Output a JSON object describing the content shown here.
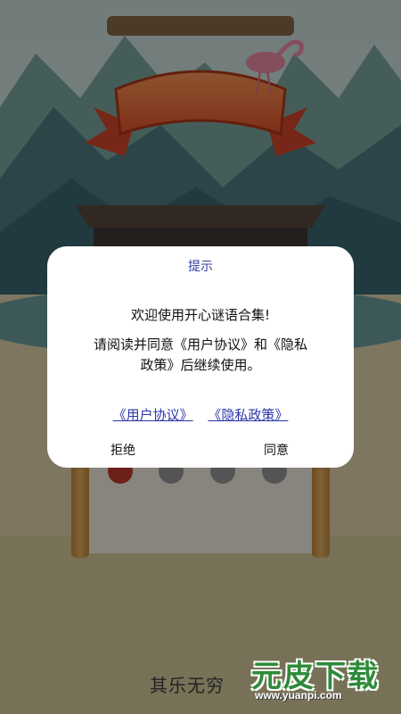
{
  "dialog": {
    "title": "提示",
    "welcome": "欢迎使用开心谜语合集!",
    "body_line1": "请阅读并同意《用户协议》和《隐私",
    "body_line2": "政策》后继续使用。",
    "link_user_agreement": "《用户协议》",
    "link_privacy_policy": "《隐私政策》",
    "reject_label": "拒绝",
    "agree_label": "同意"
  },
  "background": {
    "footer_text": "其乐无穷"
  },
  "watermark": {
    "brand": "元皮下载",
    "url": "www.yuanpi.com"
  }
}
